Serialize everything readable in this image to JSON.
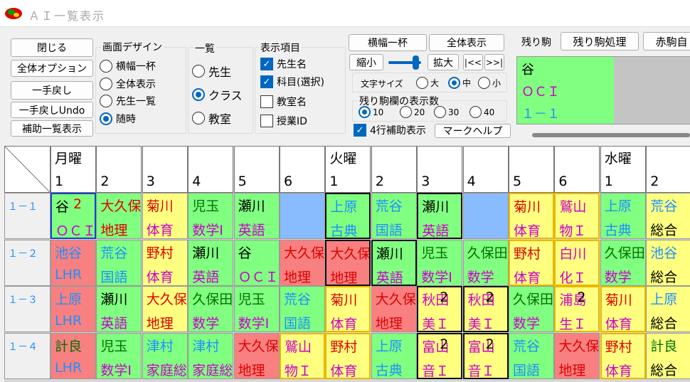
{
  "window": {
    "title": "ＡＩ一覧表示"
  },
  "buttons": {
    "close": "閉じる",
    "all_options": "全体オプション",
    "undo": "一手戻し",
    "undo_undo": "一手戻しUndo",
    "aux_list": "補助一覧表示",
    "width_full": "横幅一杯",
    "show_all": "全体表示",
    "shrink": "縮小",
    "enlarge": "拡大",
    "prev": "|<<",
    "next": ">>|",
    "remaining_proc": "残り駒処理",
    "red_piece": "赤駒自",
    "mark_help": "マークヘルプ"
  },
  "design": {
    "title": "画面デザイン",
    "options": [
      "横幅一杯",
      "全体表示",
      "先生一覧",
      "随時"
    ],
    "selected": 3
  },
  "list_mode": {
    "title": "一覧",
    "options": [
      "先生",
      "クラス",
      "教室"
    ],
    "selected": 1
  },
  "display": {
    "title": "表示項目",
    "items": [
      {
        "label": "先生名",
        "checked": true
      },
      {
        "label": "科目(選択)",
        "checked": true
      },
      {
        "label": "教室名",
        "checked": false
      },
      {
        "label": "授業ID",
        "checked": false
      }
    ]
  },
  "font_size": {
    "label": "文字サイズ",
    "options": [
      "大",
      "中",
      "小"
    ],
    "selected": 1
  },
  "remaining_count": {
    "title": "残り駒欄の表示数",
    "options": [
      "10",
      "20",
      "30",
      "40"
    ],
    "selected": 0
  },
  "four_row": {
    "label": "4行補助表示",
    "checked": true
  },
  "remaining": {
    "label": "残り駒",
    "lines": [
      "谷",
      "ＯＣＩ",
      "１－１"
    ]
  },
  "colors": {
    "green": "#80ff80",
    "red": "#f88080",
    "yellow": "#ffff80",
    "blue": "#88bbff",
    "magenta_text": "#cc00cc",
    "red_text": "#e00000",
    "blue_text": "#1e90ff",
    "dark_green_text": "#007000"
  },
  "grid": {
    "days": [
      "月曜",
      "",
      "",
      "",
      "",
      "",
      "火曜",
      "",
      "",
      "",
      "",
      "",
      "水曜",
      ""
    ],
    "periods": [
      "1",
      "2",
      "3",
      "4",
      "5",
      "6",
      "1",
      "2",
      "3",
      "4",
      "5",
      "6",
      "1",
      "2"
    ],
    "rows": [
      {
        "label": "１－１",
        "cells": [
          {
            "t": "谷",
            "s": "ＯＣＩ",
            "n": "2",
            "bg": "green",
            "tc": "black",
            "sc": "magenta",
            "nc": "red",
            "b": "sel"
          },
          {
            "t": "大久保",
            "s": "地理",
            "bg": "green",
            "tc": "red",
            "sc": "red"
          },
          {
            "t": "菊川",
            "s": "体育",
            "bg": "yellow",
            "tc": "red",
            "sc": "magenta"
          },
          {
            "t": "児玉",
            "s": "数学Ⅰ",
            "bg": "green",
            "tc": "darkgreen",
            "sc": "magenta"
          },
          {
            "t": "瀬川",
            "s": "英語",
            "bg": "green",
            "tc": "black",
            "sc": "magenta"
          },
          {
            "t": "",
            "s": "",
            "bg": "blue"
          },
          {
            "t": "上原",
            "s": "古典",
            "bg": "green",
            "tc": "blue",
            "sc": "blue",
            "b": "k"
          },
          {
            "t": "荒谷",
            "s": "国語",
            "bg": "green",
            "tc": "blue",
            "sc": "blue"
          },
          {
            "t": "瀬川",
            "s": "英語",
            "bg": "green",
            "tc": "black",
            "sc": "magenta",
            "b": "k"
          },
          {
            "t": "",
            "s": "",
            "bg": "blue"
          },
          {
            "t": "菊川",
            "s": "体育",
            "bg": "yellow",
            "tc": "red",
            "sc": "magenta",
            "b": "y"
          },
          {
            "t": "鷲山",
            "s": "物Ｉ",
            "bg": "yellow",
            "tc": "magenta",
            "sc": "magenta",
            "b": "y"
          },
          {
            "t": "上原",
            "s": "古典",
            "bg": "green",
            "tc": "blue",
            "sc": "blue"
          },
          {
            "t": "荒谷",
            "s": "総合",
            "bg": "yellow",
            "tc": "blue",
            "sc": "black"
          }
        ]
      },
      {
        "label": "１－２",
        "cells": [
          {
            "t": "池谷",
            "s": "LHR",
            "bg": "red",
            "tc": "blue",
            "sc": "blue"
          },
          {
            "t": "荒谷",
            "s": "国語",
            "bg": "green",
            "tc": "blue",
            "sc": "blue"
          },
          {
            "t": "野村",
            "s": "体育",
            "bg": "yellow",
            "tc": "red",
            "sc": "magenta"
          },
          {
            "t": "瀬川",
            "s": "英語",
            "bg": "green",
            "tc": "black",
            "sc": "magenta"
          },
          {
            "t": "谷",
            "s": "ＯＣＩ",
            "bg": "green",
            "tc": "black",
            "sc": "magenta"
          },
          {
            "t": "大久保",
            "s": "地理",
            "bg": "red",
            "tc": "red",
            "sc": "red"
          },
          {
            "t": "大久保",
            "s": "地理",
            "bg": "red",
            "tc": "red",
            "sc": "red",
            "b": "k"
          },
          {
            "t": "瀬川",
            "s": "英語",
            "bg": "green",
            "tc": "black",
            "sc": "magenta",
            "b": "k"
          },
          {
            "t": "児玉",
            "s": "数学Ⅰ",
            "bg": "green",
            "tc": "darkgreen",
            "sc": "magenta"
          },
          {
            "t": "久保田",
            "s": "数学",
            "bg": "green",
            "tc": "darkgreen",
            "sc": "magenta"
          },
          {
            "t": "野村",
            "s": "体育",
            "bg": "yellow",
            "tc": "red",
            "sc": "magenta",
            "b": "y"
          },
          {
            "t": "白川",
            "s": "化Ｉ",
            "bg": "yellow",
            "tc": "magenta",
            "sc": "magenta",
            "b": "y"
          },
          {
            "t": "久保田",
            "s": "数学",
            "bg": "green",
            "tc": "darkgreen",
            "sc": "magenta"
          },
          {
            "t": "池谷",
            "s": "総合",
            "bg": "yellow",
            "tc": "blue",
            "sc": "black"
          }
        ]
      },
      {
        "label": "１－３",
        "cells": [
          {
            "t": "上原",
            "s": "LHR",
            "bg": "red",
            "tc": "blue",
            "sc": "blue"
          },
          {
            "t": "瀬川",
            "s": "英語",
            "bg": "green",
            "tc": "black",
            "sc": "magenta"
          },
          {
            "t": "大久保",
            "s": "地理",
            "bg": "yellow",
            "tc": "red",
            "sc": "red"
          },
          {
            "t": "久保田",
            "s": "数学",
            "bg": "green",
            "tc": "darkgreen",
            "sc": "magenta"
          },
          {
            "t": "児玉",
            "s": "数学Ⅰ",
            "bg": "green",
            "tc": "darkgreen",
            "sc": "magenta"
          },
          {
            "t": "荒谷",
            "s": "国語",
            "bg": "green",
            "tc": "blue",
            "sc": "blue"
          },
          {
            "t": "菊川",
            "s": "体育",
            "bg": "yellow",
            "tc": "red",
            "sc": "magenta",
            "b": "y"
          },
          {
            "t": "大久保",
            "s": "地理",
            "bg": "red",
            "tc": "red",
            "sc": "red"
          },
          {
            "t": "秋田",
            "s": "美Ｉ",
            "n": "2",
            "bg": "yellow",
            "tc": "magenta",
            "sc": "magenta",
            "nc": "black",
            "b": "k"
          },
          {
            "t": "秋田",
            "s": "美Ｉ",
            "n": "2",
            "bg": "yellow",
            "tc": "magenta",
            "sc": "magenta",
            "nc": "black",
            "b": "k"
          },
          {
            "t": "久保田",
            "s": "数学",
            "bg": "green",
            "tc": "darkgreen",
            "sc": "magenta"
          },
          {
            "t": "浦島",
            "s": "生Ｉ",
            "n": "2",
            "bg": "yellow",
            "tc": "magenta",
            "sc": "magenta",
            "nc": "black",
            "b": "y"
          },
          {
            "t": "菊川",
            "s": "体育",
            "bg": "yellow",
            "tc": "red",
            "sc": "magenta",
            "b": "y"
          },
          {
            "t": "上原",
            "s": "総合",
            "bg": "yellow",
            "tc": "blue",
            "sc": "black"
          }
        ]
      },
      {
        "label": "１－４",
        "cells": [
          {
            "t": "計良",
            "s": "LHR",
            "bg": "red",
            "tc": "darkgreen",
            "sc": "blue"
          },
          {
            "t": "児玉",
            "s": "数学Ⅰ",
            "bg": "green",
            "tc": "darkgreen",
            "sc": "magenta"
          },
          {
            "t": "津村",
            "s": "家庭総",
            "bg": "green",
            "tc": "blue",
            "sc": "magenta"
          },
          {
            "t": "津村",
            "s": "家庭総",
            "bg": "green",
            "tc": "blue",
            "sc": "magenta"
          },
          {
            "t": "大久保",
            "s": "地理",
            "bg": "red",
            "tc": "red",
            "sc": "red"
          },
          {
            "t": "鷲山",
            "s": "物Ｉ",
            "bg": "yellow",
            "tc": "magenta",
            "sc": "magenta",
            "b": "y"
          },
          {
            "t": "野村",
            "s": "体育",
            "bg": "yellow",
            "tc": "red",
            "sc": "magenta",
            "b": "y"
          },
          {
            "t": "上原",
            "s": "古典",
            "bg": "green",
            "tc": "blue",
            "sc": "blue"
          },
          {
            "t": "富山",
            "s": "音Ｉ",
            "n": "2",
            "bg": "yellow",
            "tc": "magenta",
            "sc": "magenta",
            "nc": "black",
            "b": "k"
          },
          {
            "t": "富山",
            "s": "音Ｉ",
            "n": "2",
            "bg": "yellow",
            "tc": "magenta",
            "sc": "magenta",
            "nc": "black",
            "b": "k"
          },
          {
            "t": "荒谷",
            "s": "国語",
            "bg": "green",
            "tc": "blue",
            "sc": "blue"
          },
          {
            "t": "大久保",
            "s": "地理",
            "bg": "red",
            "tc": "red",
            "sc": "red"
          },
          {
            "t": "野村",
            "s": "体育",
            "bg": "yellow",
            "tc": "red",
            "sc": "magenta",
            "b": "y"
          },
          {
            "t": "計良",
            "s": "総合",
            "bg": "yellow",
            "tc": "darkgreen",
            "sc": "black"
          }
        ]
      }
    ]
  }
}
